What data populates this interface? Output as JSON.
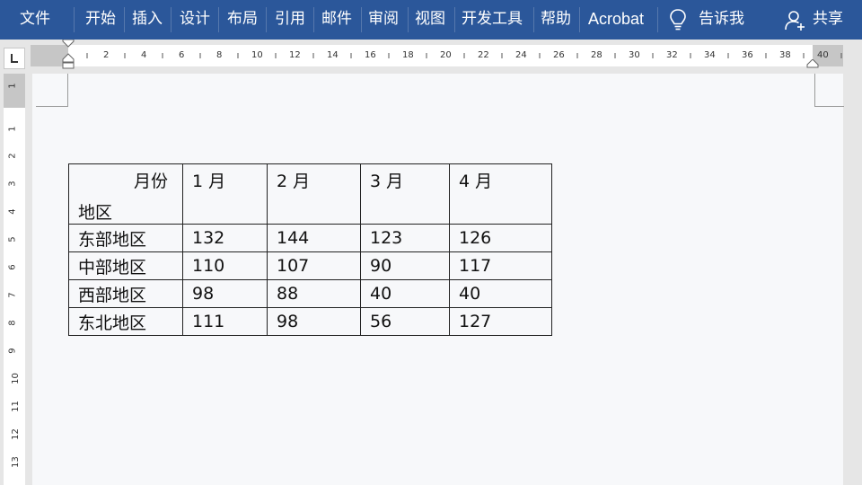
{
  "menu": {
    "items": [
      "文件",
      "开始",
      "插入",
      "设计",
      "布局",
      "引用",
      "邮件",
      "审阅",
      "视图",
      "开发工具",
      "帮助",
      "Acrobat"
    ],
    "tell_me": "告诉我",
    "share": "共享"
  },
  "ruler": {
    "h_numbers": [
      "2",
      "4",
      "6",
      "8",
      "10",
      "12",
      "14",
      "16",
      "18",
      "20",
      "22",
      "24",
      "26",
      "28",
      "30",
      "32",
      "34",
      "36",
      "38",
      "40"
    ],
    "v_numbers": [
      "1",
      "1",
      "2",
      "3",
      "4",
      "5",
      "6",
      "7",
      "8",
      "9",
      "10",
      "11",
      "12",
      "13"
    ]
  },
  "table": {
    "header": {
      "corner_top": "月份",
      "corner_bottom": "地区",
      "months": [
        "1 月",
        "2 月",
        "3 月",
        "4 月"
      ]
    },
    "rows": [
      {
        "region": "东部地区",
        "values": [
          "132",
          "144",
          "123",
          "126"
        ]
      },
      {
        "region": "中部地区",
        "values": [
          "110",
          "107",
          "90",
          "117"
        ]
      },
      {
        "region": "西部地区",
        "values": [
          "98",
          "88",
          "40",
          "40"
        ]
      },
      {
        "region": "东北地区",
        "values": [
          "111",
          "98",
          "56",
          "127"
        ]
      }
    ]
  }
}
